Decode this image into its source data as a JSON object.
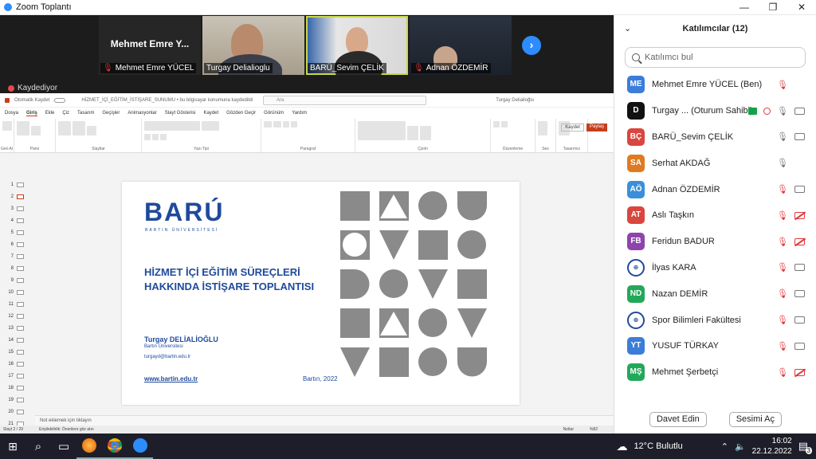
{
  "window": {
    "title": "Zoom Toplantı",
    "controls": [
      "—",
      "❐",
      "✕"
    ]
  },
  "videos": [
    {
      "name": "Mehmet Emre Y...",
      "label": "Mehmet Emre YÜCEL",
      "type": "name"
    },
    {
      "label": "Turgay Delialioglu",
      "type": "video"
    },
    {
      "label": "BARÜ_Sevim ÇELİK",
      "type": "video",
      "active": true
    },
    {
      "label": "Adnan ÖZDEMİR",
      "type": "video"
    }
  ],
  "recording": "Kaydediyor",
  "ppt": {
    "autosave": "Otomatik Kaydet",
    "doc_title": "HİZMET_İÇİ_EĞİTİM_İSTİŞARE_SUNUMU • bu bilgisayar konumuna kaydedildi",
    "search": "Ara",
    "user": "Turgay Delialioğlu",
    "menu": [
      "Dosya",
      "Giriş",
      "Ekle",
      "Çiz",
      "Tasarım",
      "Geçişler",
      "Animasyonlar",
      "Slayt Gösterisi",
      "Kaydet",
      "Gözden Geçir",
      "Görünüm",
      "Yardım"
    ],
    "menu_selected": "Giriş",
    "save_btn": "Kaydet",
    "share_btn": "Paylaş",
    "groups": [
      "Geri Al",
      "Pano",
      "Slaytlar",
      "Yazı Tipi",
      "Paragraf",
      "Çizim",
      "Düzenleme",
      "Ses",
      "Tasarımcı"
    ],
    "thumbs": [
      "1",
      "2",
      "3",
      "4",
      "5",
      "6",
      "7",
      "8",
      "9",
      "10",
      "11",
      "12",
      "13",
      "14",
      "15",
      "16",
      "17",
      "18",
      "19",
      "20",
      "21"
    ],
    "notes": "Not eklemek için tıklayın",
    "status": {
      "slide": "Slayt 2 / 29",
      "access": "Erişilebilirlik: Önerilere göz atın",
      "notes": "Notlar",
      "zoom": "%82"
    }
  },
  "slide": {
    "logo": "BARÚ",
    "logo_sub": "BARTIN ÜNİVERSİTESİ",
    "heading_1": "HİZMET İÇİ EĞİTİM SÜREÇLERİ",
    "heading_2": "HAKKINDA İSTİŞARE TOPLANTISI",
    "presenter": "Turgay DELİALİOĞLU",
    "university": "Bartın Üniversitesi",
    "email": "turgayd@bartin.edu.tr",
    "website": "www.bartin.edu.tr",
    "place_date": "Bartın, 2022"
  },
  "panel": {
    "title": "Katılımcılar (12)",
    "search_placeholder": "Katılımcı bul",
    "participants": [
      {
        "initials": "ME",
        "name": "Mehmet Emre YÜCEL (Ben)",
        "color": "#3b7dd8",
        "mic": "off",
        "cam": "none"
      },
      {
        "initials": "D",
        "name": "Turgay ... (Oturum Sahibi)",
        "color": "#111111",
        "mic": "on",
        "cam": "on",
        "host": true
      },
      {
        "initials": "BÇ",
        "name": "BARÜ_Sevim ÇELİK",
        "color": "#d9463e",
        "mic": "on",
        "cam": "on"
      },
      {
        "initials": "SA",
        "name": "Serhat AKDAĞ",
        "color": "#e07a22",
        "mic": "on",
        "cam": "none"
      },
      {
        "initials": "AÖ",
        "name": "Adnan ÖZDEMİR",
        "color": "#3b8fd8",
        "mic": "off",
        "cam": "on"
      },
      {
        "initials": "AT",
        "name": "Aslı Taşkın",
        "color": "#d9463e",
        "mic": "off",
        "cam": "off"
      },
      {
        "initials": "FB",
        "name": "Feridun BADUR",
        "color": "#8e44ad",
        "mic": "off",
        "cam": "off"
      },
      {
        "initials": "",
        "name": "İlyas KARA",
        "color": "logo",
        "mic": "off",
        "cam": "on"
      },
      {
        "initials": "ND",
        "name": "Nazan DEMİR",
        "color": "#23a859",
        "mic": "off",
        "cam": "on"
      },
      {
        "initials": "",
        "name": "Spor Bilimleri Fakültesi",
        "color": "logo",
        "mic": "off",
        "cam": "on"
      },
      {
        "initials": "YT",
        "name": "YUSUF TÜRKAY",
        "color": "#3b7dd8",
        "mic": "off",
        "cam": "on"
      },
      {
        "initials": "MŞ",
        "name": "Mehmet Şerbetçi",
        "color": "#23a859",
        "mic": "off",
        "cam": "off"
      }
    ],
    "invite_btn": "Davet Edin",
    "unmute_btn": "Sesimi Aç"
  },
  "taskbar": {
    "weather": "12°C  Bulutlu",
    "time": "16:02",
    "date": "22.12.2022",
    "notif": "3"
  }
}
